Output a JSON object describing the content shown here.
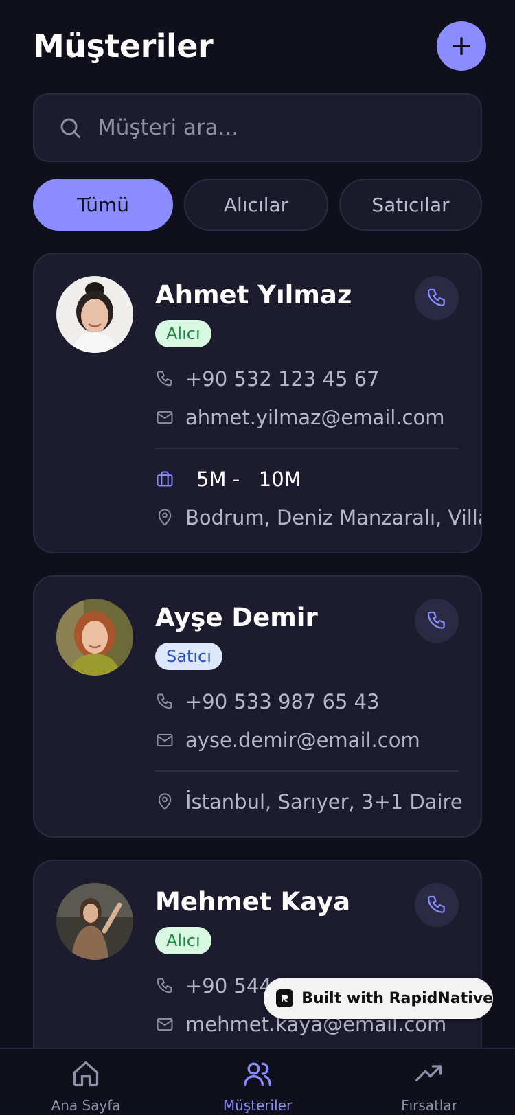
{
  "header": {
    "title": "Müşteriler"
  },
  "search": {
    "placeholder": "Müşteri ara..."
  },
  "filters": [
    {
      "label": "Tümü",
      "active": true
    },
    {
      "label": "Alıcılar",
      "active": false
    },
    {
      "label": "Satıcılar",
      "active": false
    }
  ],
  "customers": [
    {
      "name": "Ahmet Yılmaz",
      "type": "Alıcı",
      "phone": "+90 532 123 45 67",
      "email": "ahmet.yilmaz@email.com",
      "budget": "5M -   10M",
      "location": "Bodrum, Deniz Manzaralı, Villa"
    },
    {
      "name": "Ayşe Demir",
      "type": "Satıcı",
      "phone": "+90 533 987 65 43",
      "email": "ayse.demir@email.com",
      "location": "İstanbul, Sarıyer, 3+1 Daire"
    },
    {
      "name": "Mehmet Kaya",
      "type": "Alıcı",
      "phone": "+90 544 4",
      "email": "mehmet.kaya@email.com"
    }
  ],
  "watermark": {
    "label": "Built with RapidNative"
  },
  "tabs": [
    {
      "label": "Ana Sayfa",
      "icon": "home-icon",
      "active": false
    },
    {
      "label": "Müşteriler",
      "icon": "users-icon",
      "active": true
    },
    {
      "label": "Fırsatlar",
      "icon": "trending-up-icon",
      "active": false
    }
  ],
  "colors": {
    "background": "#10101d",
    "card": "#1c1c2e",
    "accent": "#8a8cff",
    "buyer_badge_bg": "#d8f8e2",
    "buyer_badge_text": "#1c8a47",
    "seller_badge_bg": "#dde8ff",
    "seller_badge_text": "#2852c4"
  }
}
